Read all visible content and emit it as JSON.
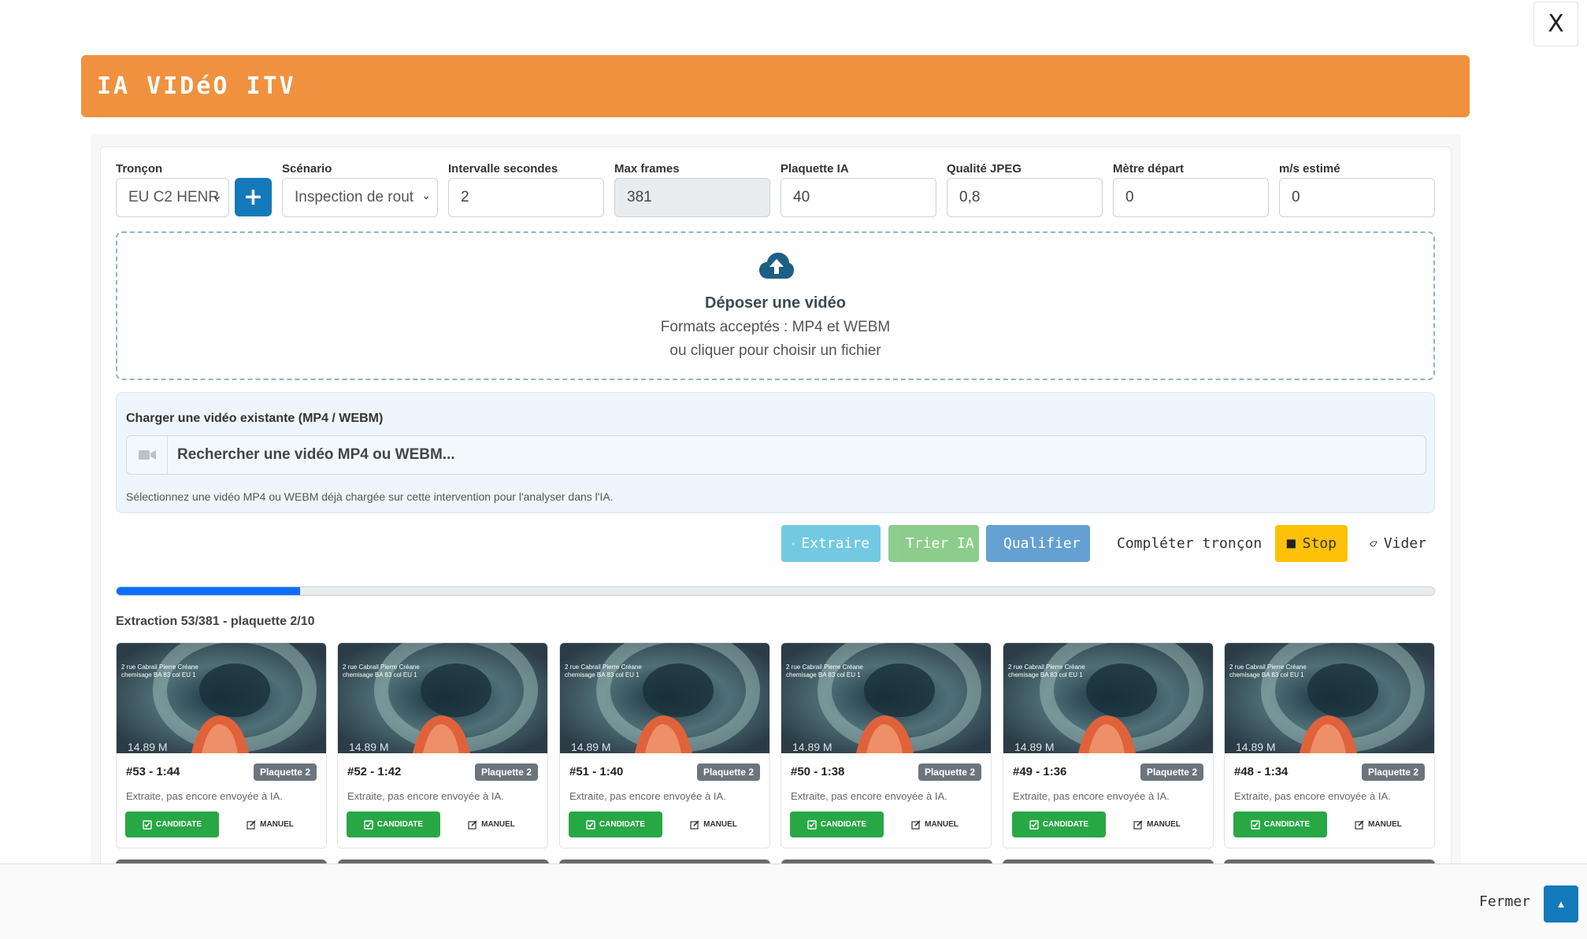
{
  "window": {
    "close_label": "X"
  },
  "header": {
    "title": "IA VIDéO ITV"
  },
  "fields": {
    "troncon": {
      "label": "Tronçon",
      "value": "EU C2 HENR"
    },
    "scenario": {
      "label": "Scénario",
      "value": "Inspection de rout"
    },
    "intervalle": {
      "label": "Intervalle secondes",
      "value": "2"
    },
    "max_frames": {
      "label": "Max frames",
      "value": "381"
    },
    "plaquette": {
      "label": "Plaquette IA",
      "value": "40"
    },
    "qualite": {
      "label": "Qualité JPEG",
      "value": "0,8"
    },
    "metre": {
      "label": "Mètre départ",
      "value": "0"
    },
    "ms": {
      "label": "m/s estimé",
      "value": "0"
    },
    "add_label": "+"
  },
  "dropzone": {
    "title": "Déposer une vidéo",
    "line1": "Formats acceptés : MP4 et WEBM",
    "line2": "ou cliquer pour choisir un fichier"
  },
  "load": {
    "title": "Charger une vidéo existante (MP4 / WEBM)",
    "search_placeholder": "Rechercher une vidéo MP4 ou WEBM...",
    "help": "Sélectionnez une vidéo MP4 ou WEBM déjà chargée sur cette intervention pour l'analyser dans l'IA."
  },
  "actions": {
    "extraire": "Extraire",
    "trier": "Trier IA",
    "qualifier": "Qualifier",
    "completer": "Compléter tronçon",
    "stop": "Stop",
    "vider": "Vider"
  },
  "progress": {
    "fraction": 0.139,
    "text": "Extraction 53/381 - plaquette 2/10"
  },
  "frames": [
    {
      "id": "#53 - 1:44",
      "badge": "Plaquette 2",
      "status": "Extraite, pas encore envoyée à IA.",
      "overlay1": "2 rue Cabrail Pierre Créane",
      "overlay2": "chemisage BA 83 col EU 1",
      "distance": "14.89 M"
    },
    {
      "id": "#52 - 1:42",
      "badge": "Plaquette 2",
      "status": "Extraite, pas encore envoyée à IA.",
      "overlay1": "2 rue Cabrail Pierre Créane",
      "overlay2": "chemisage BA 83 col EU 1",
      "distance": "14.89 M"
    },
    {
      "id": "#51 - 1:40",
      "badge": "Plaquette 2",
      "status": "Extraite, pas encore envoyée à IA.",
      "overlay1": "2 rue Cabrail Pierre Créane",
      "overlay2": "chemisage BA 83 col EU 1",
      "distance": "14.89 M"
    },
    {
      "id": "#50 - 1:38",
      "badge": "Plaquette 2",
      "status": "Extraite, pas encore envoyée à IA.",
      "overlay1": "2 rue Cabrail Pierre Créane",
      "overlay2": "chemisage BA 83 col EU 1",
      "distance": "14.89 M"
    },
    {
      "id": "#49 - 1:36",
      "badge": "Plaquette 2",
      "status": "Extraite, pas encore envoyée à IA.",
      "overlay1": "2 rue Cabrail Pierre Créane",
      "overlay2": "chemisage BA 83 col EU 1",
      "distance": "14.89 M"
    },
    {
      "id": "#48 - 1:34",
      "badge": "Plaquette 2",
      "status": "Extraite, pas encore envoyée à IA.",
      "overlay1": "2 rue Cabrail Pierre Créane",
      "overlay2": "chemisage BA 83 col EU 1",
      "distance": "14.89 M"
    }
  ],
  "frame_buttons": {
    "candidate": "CANDIDATE",
    "manuel": "MANUEL"
  },
  "footer": {
    "close_label": "Fermer"
  },
  "colors": {
    "header": "#f0913f",
    "primary": "#1479b8",
    "success": "#28a745",
    "warning": "#fec107"
  }
}
